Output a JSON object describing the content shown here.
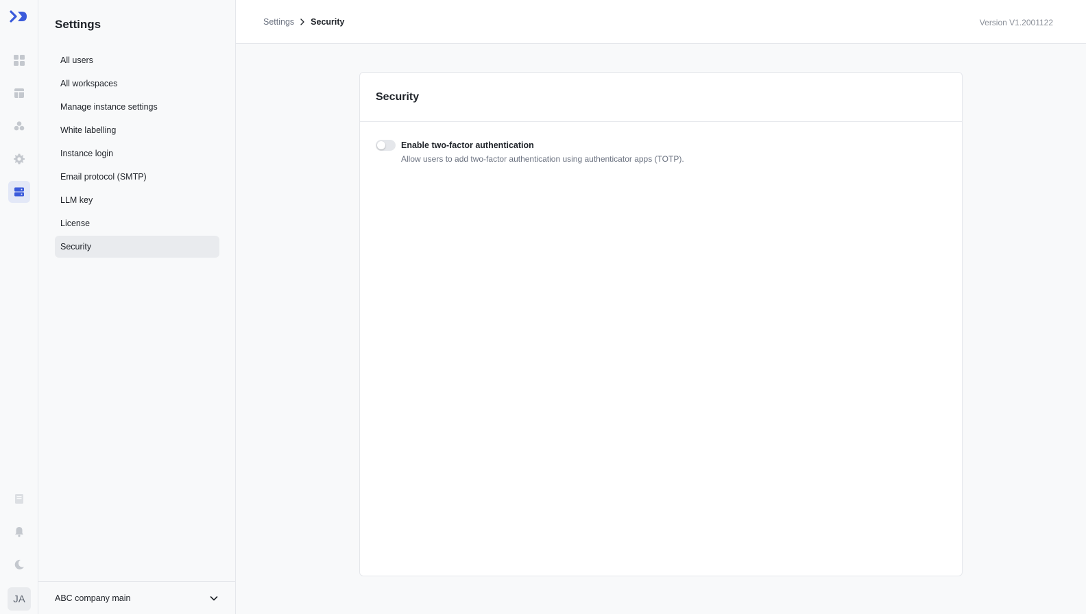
{
  "rail": {
    "icons": [
      "logo-icon",
      "dashboard-icon",
      "table-icon",
      "circles-icon",
      "gear-icon",
      "server-icon",
      "book-icon",
      "bell-icon",
      "moon-icon"
    ],
    "avatar_initials": "JA",
    "accent_color": "#3b5bdb"
  },
  "sidebar": {
    "title": "Settings",
    "items": [
      {
        "label": "All users"
      },
      {
        "label": "All workspaces"
      },
      {
        "label": "Manage instance settings"
      },
      {
        "label": "White labelling"
      },
      {
        "label": "Instance login"
      },
      {
        "label": "Email protocol (SMTP)"
      },
      {
        "label": "LLM key"
      },
      {
        "label": "License"
      },
      {
        "label": "Security",
        "active": true
      }
    ],
    "workspace": "ABC company main"
  },
  "header": {
    "breadcrumb_parent": "Settings",
    "breadcrumb_current": "Security",
    "version": "Version V1.2001122"
  },
  "card": {
    "title": "Security",
    "settings": [
      {
        "label": "Enable two-factor authentication",
        "description": "Allow users to add two-factor authentication using authenticator apps (TOTP).",
        "enabled": false
      }
    ]
  }
}
